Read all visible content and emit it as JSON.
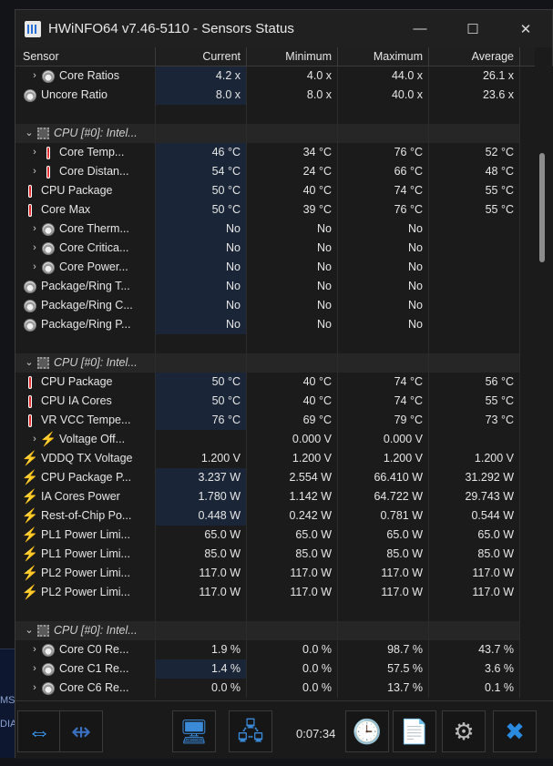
{
  "window": {
    "title": "HWiNFO64 v7.46-5110 - Sensors Status",
    "minimize": "—",
    "maximize": "☐",
    "close": "✕"
  },
  "columns": [
    "Sensor",
    "Current",
    "Minimum",
    "Maximum",
    "Average"
  ],
  "rows": [
    {
      "type": "item",
      "indent": 1,
      "expand": true,
      "icon": "gauge-icon",
      "name": "Core Ratios",
      "cur": "4.2 x",
      "min": "4.0 x",
      "max": "44.0 x",
      "avg": "26.1 x"
    },
    {
      "type": "item",
      "indent": 0,
      "expand": false,
      "icon": "gauge-icon",
      "name": "Uncore Ratio",
      "cur": "8.0 x",
      "min": "8.0 x",
      "max": "40.0 x",
      "avg": "23.6 x"
    },
    {
      "type": "blank"
    },
    {
      "type": "group",
      "name": "CPU [#0]: Intel..."
    },
    {
      "type": "item",
      "indent": 1,
      "expand": true,
      "icon": "thermometer-icon",
      "name": "Core Temp...",
      "cur": "46 °C",
      "min": "34 °C",
      "max": "76 °C",
      "avg": "52 °C"
    },
    {
      "type": "item",
      "indent": 1,
      "expand": true,
      "icon": "thermometer-icon",
      "name": "Core Distan...",
      "cur": "54 °C",
      "min": "24 °C",
      "max": "66 °C",
      "avg": "48 °C"
    },
    {
      "type": "item",
      "indent": 0,
      "expand": false,
      "icon": "thermometer-icon",
      "name": "CPU Package",
      "cur": "50 °C",
      "min": "40 °C",
      "max": "74 °C",
      "avg": "55 °C"
    },
    {
      "type": "item",
      "indent": 0,
      "expand": false,
      "icon": "thermometer-icon",
      "name": "Core Max",
      "cur": "50 °C",
      "min": "39 °C",
      "max": "76 °C",
      "avg": "55 °C"
    },
    {
      "type": "item",
      "indent": 1,
      "expand": true,
      "icon": "gauge-icon",
      "name": "Core Therm...",
      "cur": "No",
      "min": "No",
      "max": "No",
      "avg": ""
    },
    {
      "type": "item",
      "indent": 1,
      "expand": true,
      "icon": "gauge-icon",
      "name": "Core Critica...",
      "cur": "No",
      "min": "No",
      "max": "No",
      "avg": ""
    },
    {
      "type": "item",
      "indent": 1,
      "expand": true,
      "icon": "gauge-icon",
      "name": "Core Power...",
      "cur": "No",
      "min": "No",
      "max": "No",
      "avg": ""
    },
    {
      "type": "item",
      "indent": 0,
      "expand": false,
      "icon": "gauge-icon",
      "name": "Package/Ring T...",
      "cur": "No",
      "min": "No",
      "max": "No",
      "avg": ""
    },
    {
      "type": "item",
      "indent": 0,
      "expand": false,
      "icon": "gauge-icon",
      "name": "Package/Ring C...",
      "cur": "No",
      "min": "No",
      "max": "No",
      "avg": ""
    },
    {
      "type": "item",
      "indent": 0,
      "expand": false,
      "icon": "gauge-icon",
      "name": "Package/Ring P...",
      "cur": "No",
      "min": "No",
      "max": "No",
      "avg": ""
    },
    {
      "type": "blank"
    },
    {
      "type": "group",
      "name": "CPU [#0]: Intel..."
    },
    {
      "type": "item",
      "indent": 0,
      "expand": false,
      "icon": "thermometer-icon",
      "name": "CPU Package",
      "cur": "50 °C",
      "min": "40 °C",
      "max": "74 °C",
      "avg": "56 °C"
    },
    {
      "type": "item",
      "indent": 0,
      "expand": false,
      "icon": "thermometer-icon",
      "name": "CPU IA Cores",
      "cur": "50 °C",
      "min": "40 °C",
      "max": "74 °C",
      "avg": "55 °C"
    },
    {
      "type": "item",
      "indent": 0,
      "expand": false,
      "icon": "thermometer-icon",
      "name": "VR VCC Tempe...",
      "cur": "76 °C",
      "min": "69 °C",
      "max": "79 °C",
      "avg": "73 °C"
    },
    {
      "type": "item",
      "indent": 1,
      "expand": true,
      "icon": "bolt-icon",
      "name": "Voltage Off...",
      "cur": "",
      "min": "0.000 V",
      "max": "0.000 V",
      "avg": "",
      "plain": true
    },
    {
      "type": "item",
      "indent": 0,
      "expand": false,
      "icon": "bolt-icon",
      "name": "VDDQ TX Voltage",
      "cur": "1.200 V",
      "min": "1.200 V",
      "max": "1.200 V",
      "avg": "1.200 V",
      "plain": true
    },
    {
      "type": "item",
      "indent": 0,
      "expand": false,
      "icon": "bolt-icon",
      "name": "CPU Package P...",
      "cur": "3.237 W",
      "min": "2.554 W",
      "max": "66.410 W",
      "avg": "31.292 W"
    },
    {
      "type": "item",
      "indent": 0,
      "expand": false,
      "icon": "bolt-icon",
      "name": "IA Cores Power",
      "cur": "1.780 W",
      "min": "1.142 W",
      "max": "64.722 W",
      "avg": "29.743 W"
    },
    {
      "type": "item",
      "indent": 0,
      "expand": false,
      "icon": "bolt-icon",
      "name": "Rest-of-Chip Po...",
      "cur": "0.448 W",
      "min": "0.242 W",
      "max": "0.781 W",
      "avg": "0.544 W"
    },
    {
      "type": "item",
      "indent": 0,
      "expand": false,
      "icon": "bolt-icon",
      "name": "PL1 Power Limi...",
      "cur": "65.0 W",
      "min": "65.0 W",
      "max": "65.0 W",
      "avg": "65.0 W",
      "plain": true
    },
    {
      "type": "item",
      "indent": 0,
      "expand": false,
      "icon": "bolt-icon",
      "name": "PL1 Power Limi...",
      "cur": "85.0 W",
      "min": "85.0 W",
      "max": "85.0 W",
      "avg": "85.0 W",
      "plain": true
    },
    {
      "type": "item",
      "indent": 0,
      "expand": false,
      "icon": "bolt-icon",
      "name": "PL2 Power Limi...",
      "cur": "117.0 W",
      "min": "117.0 W",
      "max": "117.0 W",
      "avg": "117.0 W",
      "plain": true
    },
    {
      "type": "item",
      "indent": 0,
      "expand": false,
      "icon": "bolt-icon",
      "name": "PL2 Power Limi...",
      "cur": "117.0 W",
      "min": "117.0 W",
      "max": "117.0 W",
      "avg": "117.0 W",
      "plain": true
    },
    {
      "type": "blank"
    },
    {
      "type": "group",
      "name": "CPU [#0]: Intel..."
    },
    {
      "type": "item",
      "indent": 1,
      "expand": true,
      "icon": "gauge-icon",
      "name": "Core C0 Re...",
      "cur": "1.9 %",
      "min": "0.0 %",
      "max": "98.7 %",
      "avg": "43.7 %",
      "plain": true
    },
    {
      "type": "item",
      "indent": 1,
      "expand": true,
      "icon": "gauge-icon",
      "name": "Core C1 Re...",
      "cur": "1.4 %",
      "min": "0.0 %",
      "max": "57.5 %",
      "avg": "3.6 %"
    },
    {
      "type": "item",
      "indent": 1,
      "expand": true,
      "icon": "gauge-icon",
      "name": "Core C6 Re...",
      "cur": "0.0 %",
      "min": "0.0 %",
      "max": "13.7 %",
      "avg": "0.1 %",
      "plain": true
    }
  ],
  "toolbar": {
    "timer": "0:07:34",
    "buttons": [
      {
        "name": "expand-arrows-icon",
        "sym": "⇔",
        "color": "#3aa0ff"
      },
      {
        "name": "collapse-arrows-icon",
        "sym": "⇹",
        "color": "#3a70c0"
      },
      {
        "name": "network-sensor-icon",
        "sym": "🖥",
        "color": "#3a8ad8"
      },
      {
        "name": "network-share-icon",
        "sym": "🖧",
        "color": "#3a8ad8"
      },
      {
        "name": "clock-icon",
        "sym": "🕒",
        "color": "#e0e0e0"
      },
      {
        "name": "logging-icon",
        "sym": "📄",
        "color": "#e0e0e0"
      },
      {
        "name": "settings-gear-icon",
        "sym": "⚙",
        "color": "#bbbbbb"
      },
      {
        "name": "close-x-icon",
        "sym": "✖",
        "color": "#2a8ae0"
      }
    ]
  },
  "desktop_snippets": [
    "MS",
    "DIA"
  ]
}
